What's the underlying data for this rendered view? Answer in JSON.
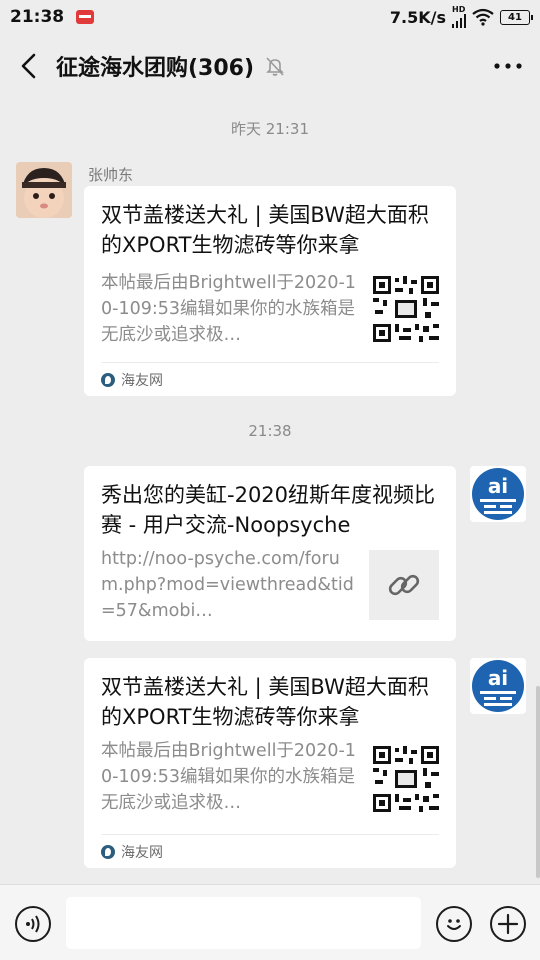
{
  "status": {
    "time": "21:38",
    "net_speed": "7.5K/s",
    "hd_top": "HD",
    "hd_bottom": "",
    "battery": "41"
  },
  "nav": {
    "title": "征途海水团购(306)"
  },
  "messages": [
    {
      "timestamp": "昨天 21:31",
      "sender": "张帅东",
      "card": {
        "title": "双节盖楼送大礼 | 美国BW超大面积的XPORT生物滤砖等你来拿",
        "desc": "本帖最后由Brightwell于2020-10-109:53编辑如果你的水族箱是无底沙或追求极…",
        "source": "海友网"
      }
    },
    {
      "timestamp": "21:38",
      "card": {
        "title": "秀出您的美缸-2020纽斯年度视频比赛 - 用户交流-Noopsyche",
        "desc": "http://noo-psyche.com/forum.php?mod=viewthread&tid=57&mobi…"
      }
    },
    {
      "card": {
        "title": "双节盖楼送大礼 | 美国BW超大面积的XPORT生物滤砖等你来拿",
        "desc": "本帖最后由Brightwell于2020-10-109:53编辑如果你的水族箱是无底沙或追求极…",
        "source": "海友网"
      }
    }
  ],
  "avatar_ai_text": "ai",
  "input": {
    "placeholder": ""
  },
  "colors": {
    "background": "#ededed",
    "card": "#ffffff",
    "ai_badge": "#1f64b0",
    "source_dot": "#2b5d7c"
  }
}
